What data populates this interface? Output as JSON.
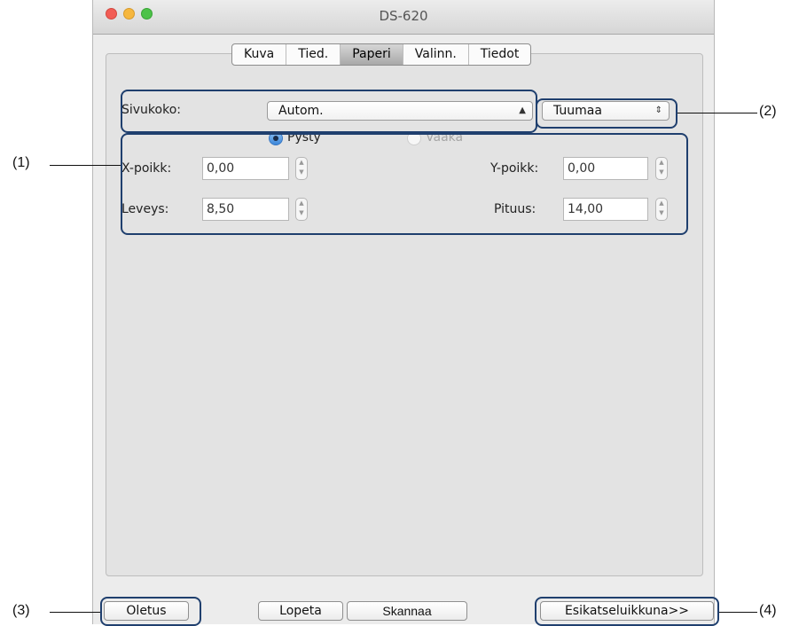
{
  "window": {
    "title": "DS-620"
  },
  "tabs": [
    {
      "label": "Kuva",
      "active": false
    },
    {
      "label": "Tied.",
      "active": false
    },
    {
      "label": "Paperi",
      "active": true
    },
    {
      "label": "Valinn.",
      "active": false
    },
    {
      "label": "Tiedot",
      "active": false
    }
  ],
  "paper": {
    "page_size_label": "Sivukoko:",
    "page_size_value": "Autom.",
    "unit_value": "Tuumaa",
    "orientation_portrait": "Pysty",
    "orientation_landscape": "Vaaka",
    "x_offset_label": "X-poikk:",
    "x_offset_value": "0,00",
    "y_offset_label": "Y-poikk:",
    "y_offset_value": "0,00",
    "width_label": "Leveys:",
    "width_value": "8,50",
    "length_label": "Pituus:",
    "length_value": "14,00"
  },
  "buttons": {
    "default": "Oletus",
    "quit": "Lopeta",
    "scan": "Skannaa",
    "preview": "Esikatseluikkuna>>"
  },
  "callouts": {
    "c1": "(1)",
    "c2": "(2)",
    "c3": "(3)",
    "c4": "(4)"
  }
}
